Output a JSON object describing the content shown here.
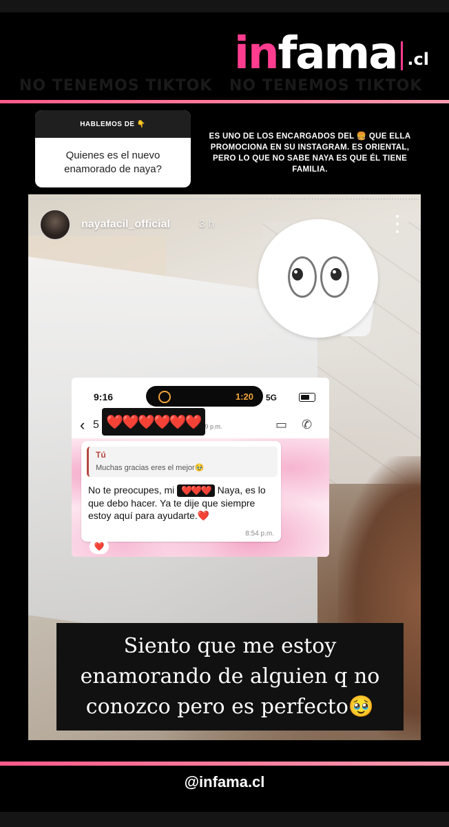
{
  "header": {
    "logo_part1": "in",
    "logo_part2": "fama",
    "logo_tld": ".cl",
    "banner_left": "NO TENEMOS TIKTOK",
    "banner_right": "NO TENEMOS TIKTOK"
  },
  "question": {
    "title": "HABLEMOS DE 👇",
    "text": "Quienes es el nuevo enamorado de naya?"
  },
  "answer": "ES UNO DE LOS ENCARGADOS DEL 🍔 QUE ELLA PROMOCIONA EN SU INSTAGRAM. ES ORIENTAL, PERO LO QUE NO SABE NAYA ES QUE ÉL TIENE FAMILIA.",
  "story": {
    "username": "nayafacil_official",
    "time": "3 h",
    "sticker": "👀"
  },
  "phone": {
    "status_time": "9:16",
    "island_time": "1:20",
    "network": "5G",
    "contact_prefix": "5",
    "contact_redacted": "❤️❤️❤️❤️❤️❤️",
    "last_seen": "...(3) 9:09 p.m.",
    "quote_name": "Tú",
    "quote_text": "Muchas gracias eres el mejor🥹",
    "msg_before": "No te preocupes, mi ",
    "msg_redacted": "❤️❤️❤️",
    "msg_after": " Naya, es lo que debo hacer. Ya te dije que siempre estoy aquí para ayudarte.❤️",
    "msg_time": "8:54 p.m.",
    "reaction": "❤️"
  },
  "caption": "Siento que me estoy enamorando de alguien q no conozco pero es perfecto🥹",
  "footer": {
    "handle": "@infama.cl"
  }
}
